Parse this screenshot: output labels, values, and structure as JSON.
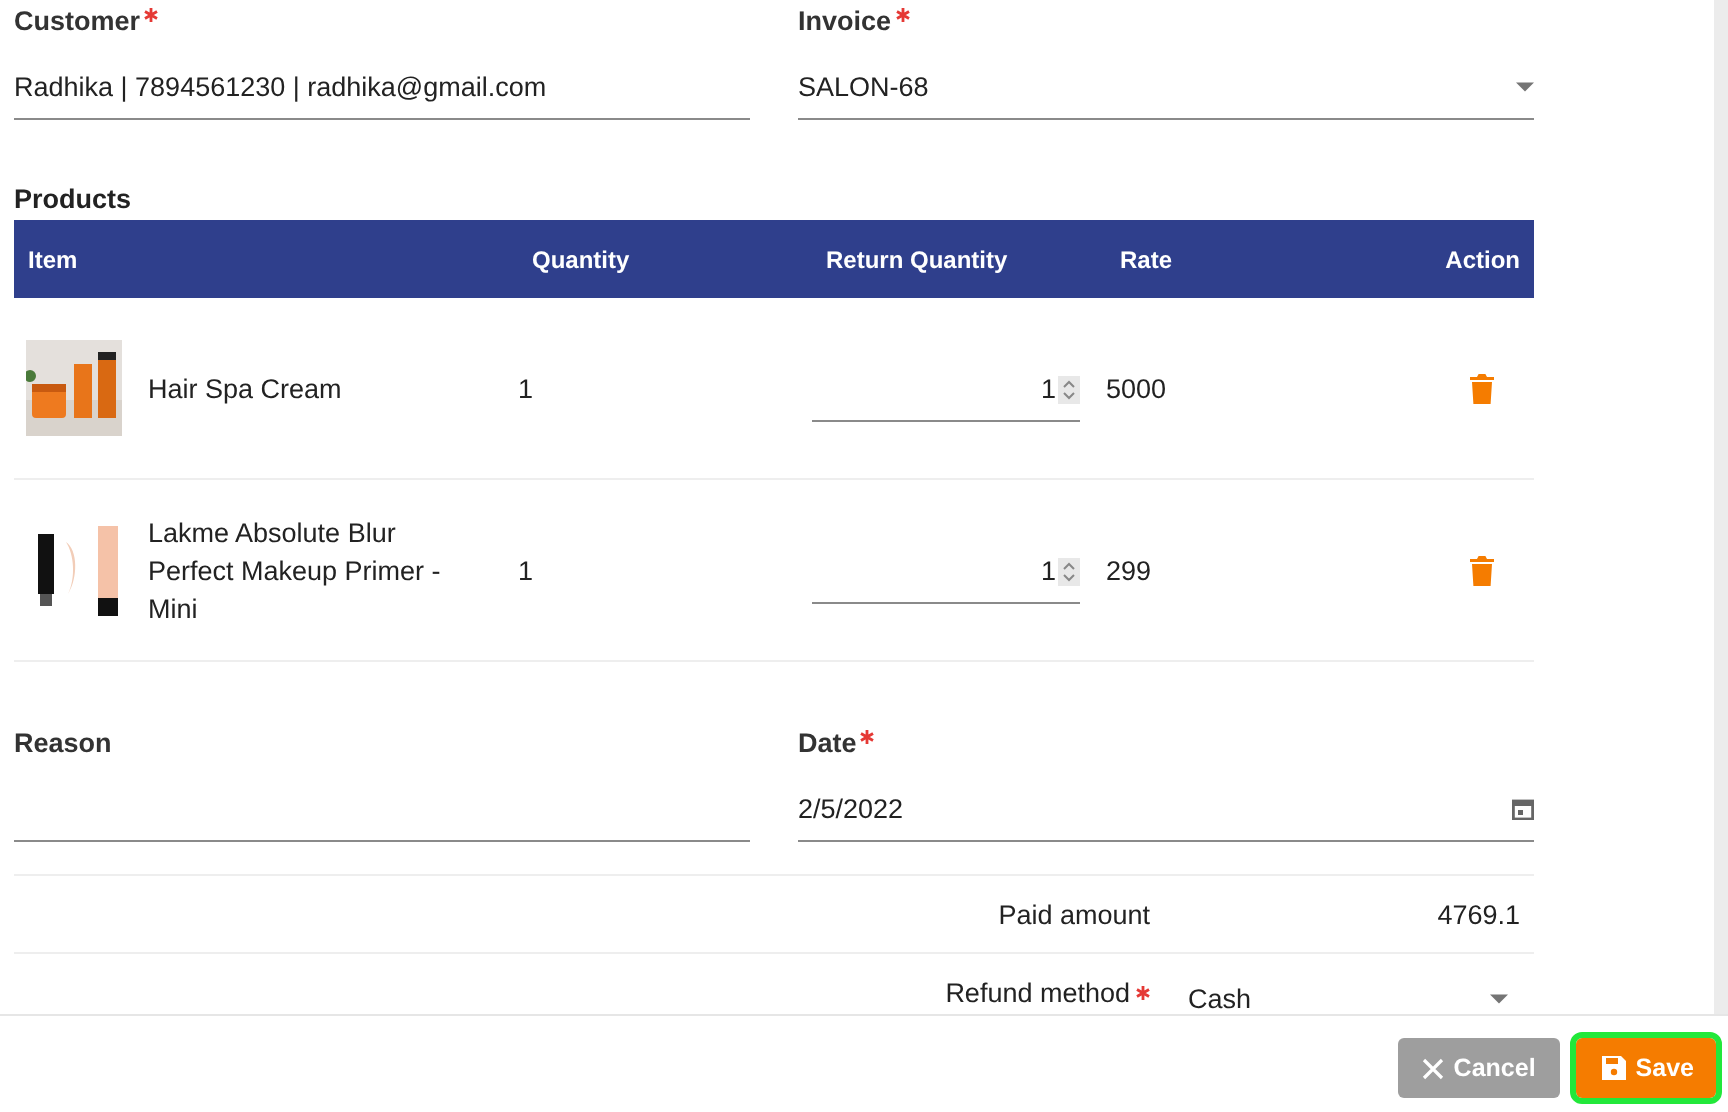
{
  "customer": {
    "label": "Customer",
    "required": true,
    "value": "Radhika | 7894561230 | radhika@gmail.com"
  },
  "invoice": {
    "label": "Invoice",
    "required": true,
    "value": "SALON-68"
  },
  "products": {
    "label": "Products",
    "columns": [
      "Item",
      "Quantity",
      "Return Quantity",
      "Rate",
      "Action"
    ],
    "rows": [
      {
        "item": "Hair Spa Cream",
        "quantity": "1",
        "return_quantity": "1",
        "rate": "5000"
      },
      {
        "item": "Lakme Absolute Blur Perfect Makeup Primer - Mini",
        "quantity": "1",
        "return_quantity": "1",
        "rate": "299"
      }
    ]
  },
  "reason": {
    "label": "Reason",
    "required": false
  },
  "date": {
    "label": "Date",
    "required": true,
    "value": "2/5/2022"
  },
  "paid_amount": {
    "label": "Paid amount",
    "value": "4769.1"
  },
  "refund_method": {
    "label": "Refund method",
    "required": true,
    "value": "Cash"
  },
  "buttons": [
    {
      "kind": "cancel",
      "label": "Cancel",
      "focused": false
    },
    {
      "kind": "save",
      "label": "Save",
      "focused": true
    }
  ]
}
